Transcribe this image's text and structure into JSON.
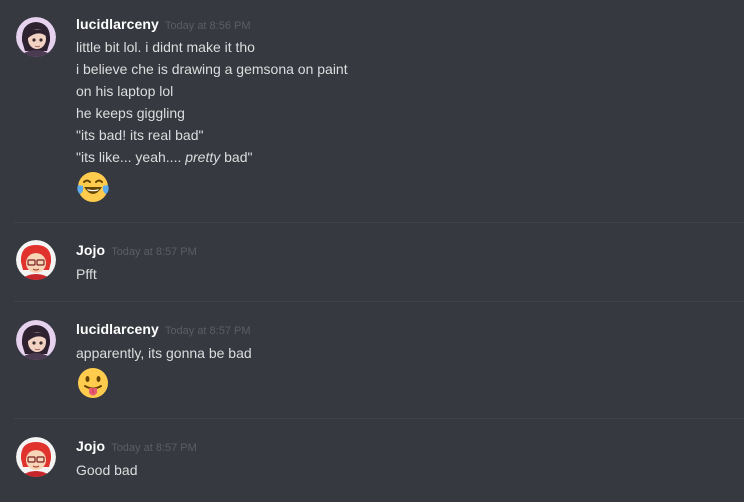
{
  "messages": [
    {
      "username": "lucidlarceny",
      "timestamp": "Today at 8:56 PM",
      "avatar": "dark-haired-character-avatar",
      "lines": [
        {
          "text": "little bit lol. i didnt make it tho"
        },
        {
          "text": "i believe che is drawing a gemsona on paint"
        },
        {
          "text": "on his laptop lol"
        },
        {
          "text": "he keeps giggling"
        },
        {
          "text": "\"its bad! its real bad\""
        },
        {
          "pre": "\"its like... yeah.... ",
          "em": "pretty",
          "post": " bad\""
        }
      ],
      "emoji": "face-with-tears-of-joy-emoji"
    },
    {
      "username": "Jojo",
      "timestamp": "Today at 8:57 PM",
      "avatar": "red-haired-character-avatar",
      "lines": [
        {
          "text": "Pfft"
        }
      ]
    },
    {
      "username": "lucidlarceny",
      "timestamp": "Today at 8:57 PM",
      "avatar": "dark-haired-character-avatar",
      "lines": [
        {
          "text": "apparently, its gonna be bad"
        }
      ],
      "emoji": "face-with-tongue-emoji"
    },
    {
      "username": "Jojo",
      "timestamp": "Today at 8:57 PM",
      "avatar": "red-haired-character-avatar",
      "lines": [
        {
          "text": "Good bad"
        }
      ]
    }
  ],
  "colors": {
    "background": "#36393f",
    "username": "#ffffff",
    "message_text": "#dcddde",
    "timestamp": "#5b5e63",
    "divider": "#3f4248"
  }
}
